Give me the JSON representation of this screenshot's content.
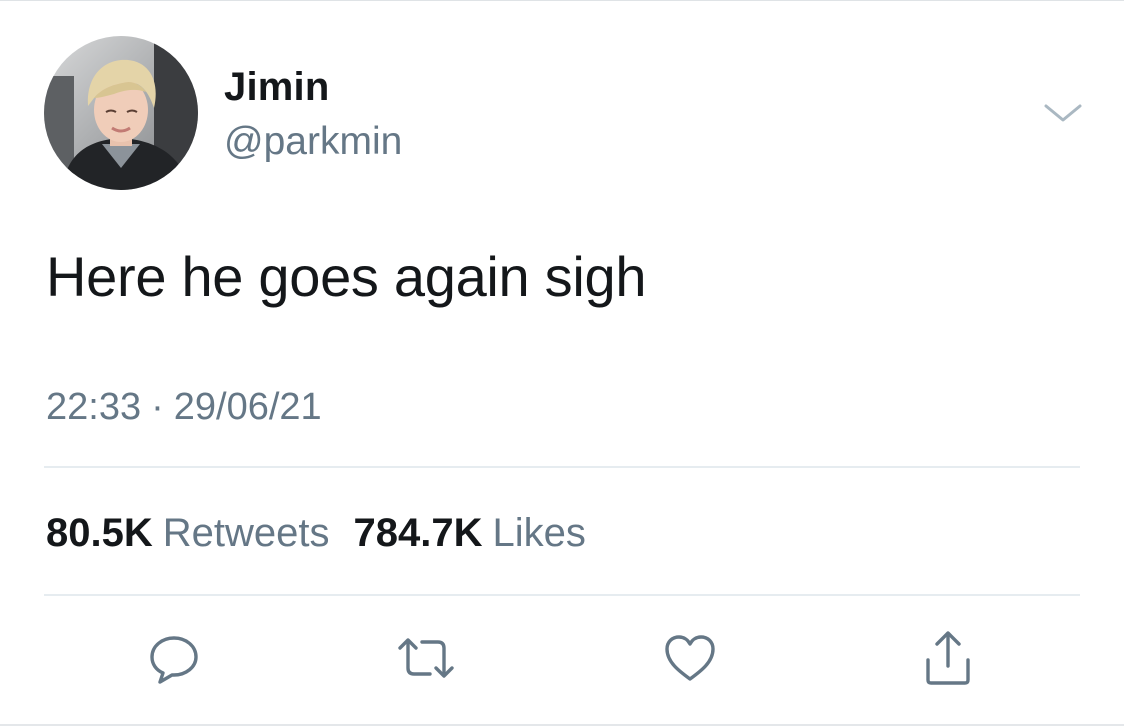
{
  "tweet": {
    "author": {
      "name": "Jimin",
      "handle": "@parkmin"
    },
    "text": "Here he goes again sigh",
    "time": "22:33",
    "separator": "·",
    "date": "29/06/21",
    "stats": {
      "retweets_count": "80.5K",
      "retweets_label": "Retweets",
      "likes_count": "784.7K",
      "likes_label": "Likes"
    }
  },
  "icons": {
    "more": "chevron-down-icon",
    "reply": "reply-icon",
    "retweet": "retweet-icon",
    "like": "heart-icon",
    "share": "share-icon"
  },
  "colors": {
    "text_primary": "#14171a",
    "text_secondary": "#657786",
    "icon": "#657786",
    "divider": "#e6ecf0"
  }
}
